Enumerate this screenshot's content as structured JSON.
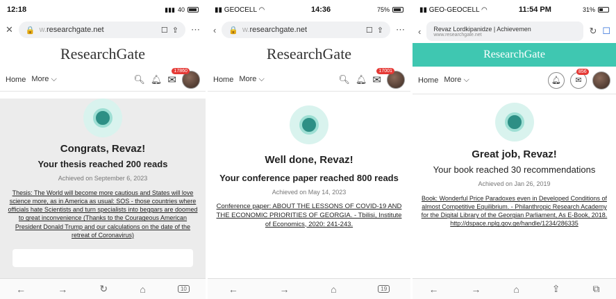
{
  "phones": [
    {
      "status": {
        "time": "12:18",
        "right": "40"
      },
      "url": {
        "host": "researchgate.net",
        "prefix": "w."
      },
      "brand": "ResearchGate",
      "nav": {
        "home": "Home",
        "more": "More ⌵",
        "badge": "17860"
      },
      "title": "Congrats, Revaz!",
      "subtitle": "Your thesis reached 200 reads",
      "date": "Achieved on September 6, 2023",
      "description": "Thesis: The World will become more cautious and States will love science more, as in America as usual: SOS - those countries where officials hate Scientists and turn specialists into beggars are doomed to great inconvenience (Thanks to the Courageous American President Donald Trump and our calculations on the date of the retreat of Coronavirus)",
      "tabs": "10"
    },
    {
      "status": {
        "carrier": "GEOCELL",
        "time": "14:36",
        "battery": "75%"
      },
      "url": {
        "host": "researchgate.net",
        "prefix": "w."
      },
      "brand": "ResearchGate",
      "nav": {
        "home": "Home",
        "more": "More ⌵",
        "badge": "17001"
      },
      "title": "Well done, Revaz!",
      "subtitle": "Your conference paper reached 800 reads",
      "date": "Achieved on May 14, 2023",
      "description": "Conference paper: ABOUT THE LESSONS OF COVID-19 AND THE ECONOMIC PRIORITIES OF GEORGIA. - Tbilisi, Institute of Economics, 2020: 241-243.",
      "tabs": "19"
    },
    {
      "status": {
        "carrier": "GEO-GEOCELL",
        "time": "11:54 PM",
        "battery": "31%"
      },
      "url": {
        "title": "Revaz Lordkipanidze | Achievemen",
        "host": "www.researchgate.net"
      },
      "brand": "ResearchGate",
      "nav": {
        "home": "Home",
        "more": "More ⌵",
        "badge": "856"
      },
      "title": "Great job, Revaz!",
      "subtitle": "Your book reached 30 recommendations",
      "date": "Achieved on Jan 26, 2019",
      "description": "Book: Wonderful Price Paradoxes even in Developed Conditions of almost Competitive Equilibrium. - Philanthropic Research Academy for the Digital Library of the Georgian Parliament, As E-Book, 2018. http://dspace.nplg.gov.ge/handle/1234/286335"
    }
  ]
}
